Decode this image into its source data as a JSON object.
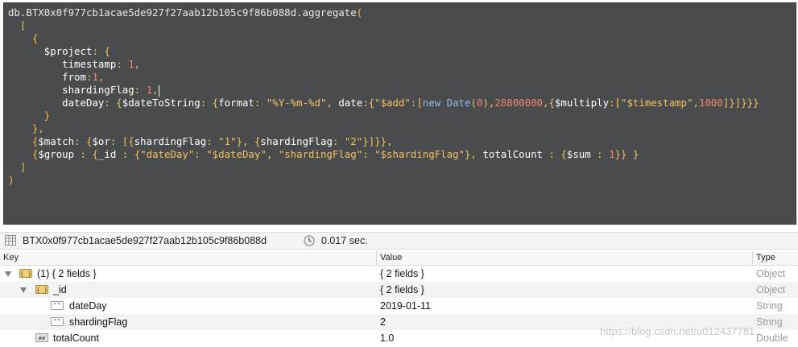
{
  "editor": {
    "lines": [
      {
        "tokens": [
          {
            "t": "db.BTX0x0f977cb1acae5de927f27aab12b105c9f86b088d.aggregate",
            "c": "default"
          },
          {
            "t": "(",
            "c": "bracket"
          }
        ]
      },
      {
        "tokens": [
          {
            "t": "  [",
            "c": "bracket"
          }
        ]
      },
      {
        "tokens": [
          {
            "t": "    {",
            "c": "bracket"
          }
        ]
      },
      {
        "tokens": [
          {
            "t": "      $project",
            "c": "key"
          },
          {
            "t": ": {",
            "c": "punct"
          }
        ]
      },
      {
        "tokens": [
          {
            "t": "         timestamp",
            "c": "key"
          },
          {
            "t": ": ",
            "c": "punct"
          },
          {
            "t": "1",
            "c": "number"
          },
          {
            "t": ",",
            "c": "punct"
          }
        ]
      },
      {
        "tokens": [
          {
            "t": "         from",
            "c": "key"
          },
          {
            "t": ":",
            "c": "punct"
          },
          {
            "t": "1",
            "c": "number"
          },
          {
            "t": ",",
            "c": "punct"
          }
        ]
      },
      {
        "tokens": [
          {
            "t": "         shardingFlag",
            "c": "key"
          },
          {
            "t": ": ",
            "c": "punct"
          },
          {
            "t": "1",
            "c": "number"
          },
          {
            "t": ",",
            "c": "punct"
          },
          {
            "t": "",
            "c": "cursor"
          }
        ]
      },
      {
        "tokens": [
          {
            "t": "         dateDay",
            "c": "key"
          },
          {
            "t": ": {",
            "c": "punct"
          },
          {
            "t": "$dateToString",
            "c": "key"
          },
          {
            "t": ": {",
            "c": "punct"
          },
          {
            "t": "format",
            "c": "key"
          },
          {
            "t": ": ",
            "c": "punct"
          },
          {
            "t": "\"%Y-%m-%d\"",
            "c": "string"
          },
          {
            "t": ", ",
            "c": "punct"
          },
          {
            "t": "date",
            "c": "key"
          },
          {
            "t": ":{",
            "c": "punct"
          },
          {
            "t": "\"$add\"",
            "c": "string"
          },
          {
            "t": ":[",
            "c": "punct"
          },
          {
            "t": "new Date",
            "c": "fn"
          },
          {
            "t": "(",
            "c": "punct"
          },
          {
            "t": "0",
            "c": "number"
          },
          {
            "t": "),",
            "c": "punct"
          },
          {
            "t": "28800000",
            "c": "number"
          },
          {
            "t": ",{",
            "c": "punct"
          },
          {
            "t": "$multiply",
            "c": "key"
          },
          {
            "t": ":[",
            "c": "punct"
          },
          {
            "t": "\"$timestamp\"",
            "c": "string"
          },
          {
            "t": ",",
            "c": "punct"
          },
          {
            "t": "1000",
            "c": "number"
          },
          {
            "t": "]}]}}}",
            "c": "punct"
          }
        ]
      },
      {
        "tokens": [
          {
            "t": "      }",
            "c": "brace"
          }
        ]
      },
      {
        "tokens": [
          {
            "t": "    },",
            "c": "brace"
          }
        ]
      },
      {
        "tokens": [
          {
            "t": "    {",
            "c": "brace"
          },
          {
            "t": "$match",
            "c": "key"
          },
          {
            "t": ": {",
            "c": "punct"
          },
          {
            "t": "$or",
            "c": "key"
          },
          {
            "t": ": [{",
            "c": "punct"
          },
          {
            "t": "shardingFlag",
            "c": "key"
          },
          {
            "t": ": ",
            "c": "punct"
          },
          {
            "t": "\"1\"",
            "c": "string"
          },
          {
            "t": "}, {",
            "c": "punct"
          },
          {
            "t": "shardingFlag",
            "c": "key"
          },
          {
            "t": ": ",
            "c": "punct"
          },
          {
            "t": "\"2\"",
            "c": "string"
          },
          {
            "t": "}]}},",
            "c": "punct"
          }
        ]
      },
      {
        "tokens": [
          {
            "t": "    {",
            "c": "brace"
          },
          {
            "t": "$group",
            "c": "key"
          },
          {
            "t": " : {",
            "c": "punct"
          },
          {
            "t": "_id",
            "c": "key"
          },
          {
            "t": " : {",
            "c": "punct"
          },
          {
            "t": "\"dateDay\"",
            "c": "string"
          },
          {
            "t": ": ",
            "c": "punct"
          },
          {
            "t": "\"$dateDay\"",
            "c": "string"
          },
          {
            "t": ", ",
            "c": "punct"
          },
          {
            "t": "\"shardingFlag\"",
            "c": "string"
          },
          {
            "t": ": ",
            "c": "punct"
          },
          {
            "t": "\"$shardingFlag\"",
            "c": "string"
          },
          {
            "t": "}, ",
            "c": "punct"
          },
          {
            "t": "totalCount",
            "c": "key"
          },
          {
            "t": " : {",
            "c": "punct"
          },
          {
            "t": "$sum",
            "c": "key"
          },
          {
            "t": " : ",
            "c": "punct"
          },
          {
            "t": "1",
            "c": "number"
          },
          {
            "t": "}} }",
            "c": "punct"
          }
        ]
      },
      {
        "tokens": [
          {
            "t": "  ]",
            "c": "bracket"
          }
        ]
      },
      {
        "tokens": [
          {
            "t": ")",
            "c": "bracket"
          }
        ]
      }
    ]
  },
  "status": {
    "collection": "BTX0x0f977cb1acae5de927f27aab12b105c9f86b088d",
    "time": "0.017 sec.",
    "table_icon": "table-icon",
    "clock_icon": "clock-icon"
  },
  "grid": {
    "columns": [
      "Key",
      "Value",
      "Type"
    ],
    "rows": [
      {
        "key": "(1) { 2 fields }",
        "value": "{ 2 fields }",
        "type": "Object",
        "icon": "object-icon",
        "expanded": true
      },
      {
        "key": "_id",
        "value": "{ 2 fields }",
        "type": "Object",
        "icon": "object-icon",
        "expanded": true
      },
      {
        "key": "dateDay",
        "value": "2019-01-11",
        "type": "String",
        "icon": "string-icon"
      },
      {
        "key": "shardingFlag",
        "value": "2",
        "type": "String",
        "icon": "string-icon"
      },
      {
        "key": "totalCount",
        "value": "1.0",
        "type": "Double",
        "icon": "number-icon"
      }
    ]
  },
  "watermark": "https://blog.csdn.net/u012437781"
}
